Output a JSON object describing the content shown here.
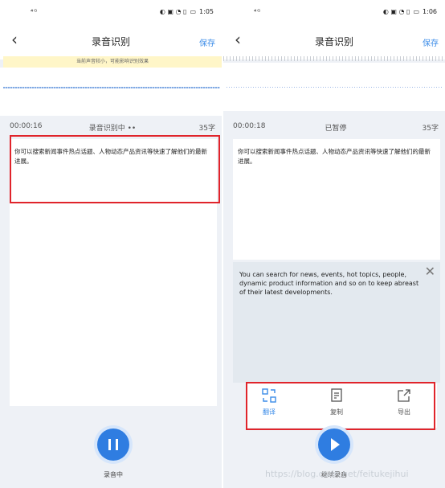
{
  "left": {
    "status": {
      "signal": "⁴ᴳ",
      "time": "1:05"
    },
    "nav": {
      "back": "‹",
      "title": "录音识别",
      "save": "保存"
    },
    "hint": "当前声音较小，可能影响识别效果",
    "info": {
      "time": "00:00:16",
      "state": "录音识别中 ••",
      "count": "35字"
    },
    "text": "你可以搜索新闻事件热点话题、人物动态产品资讯等快速了解他们的最新进展。",
    "fab_label": "录音中"
  },
  "right": {
    "status": {
      "signal": "⁴ᴳ",
      "time": "1:06"
    },
    "nav": {
      "back": "‹",
      "title": "录音识别",
      "save": "保存"
    },
    "info": {
      "time": "00:00:18",
      "state": "已暂停",
      "count": "35字"
    },
    "text": "你可以搜索新闻事件热点话题、人物动态产品资讯等快速了解他们的最新进展。",
    "translation": "You can search for news, events, hot topics, people, dynamic product information and so on to keep abreast of their latest developments.",
    "close": "✕",
    "tools": [
      {
        "label": "翻译",
        "icon": "translate-icon",
        "color": "#3a8be8"
      },
      {
        "label": "复制",
        "icon": "copy-icon",
        "color": "#555555"
      },
      {
        "label": "导出",
        "icon": "export-icon",
        "color": "#555555"
      }
    ],
    "fab_label": "继续录音"
  },
  "watermark": "https://blog.csdn.net/feitukejihui",
  "colors": {
    "accent": "#2f7de1",
    "highlight": "#e0242b",
    "hint_bg": "#fff6c8"
  }
}
